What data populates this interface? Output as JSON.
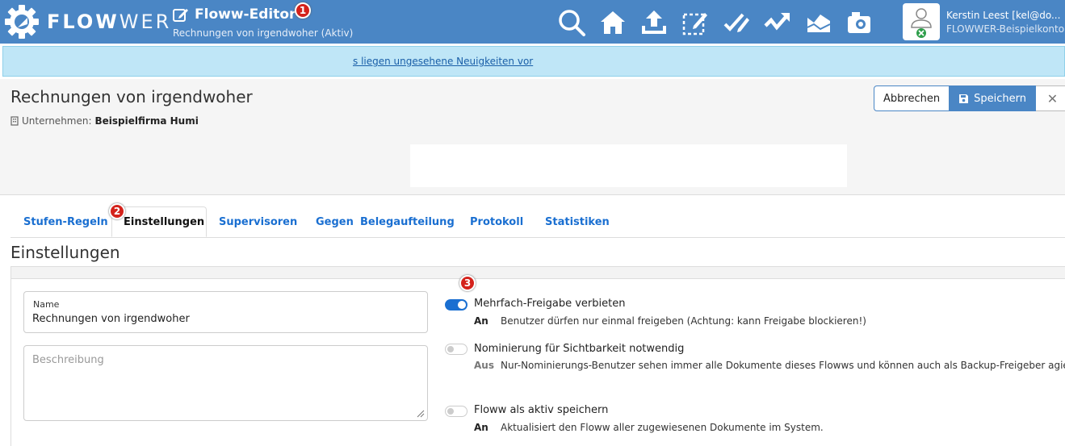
{
  "brand": {
    "logo_bold": "FLOW",
    "logo_thin": "WER",
    "accent": "#4a86c5",
    "danger": "#d4221b"
  },
  "editor": {
    "title": "Floww-Editor",
    "subtitle": "Rechnungen von irgendwoher (Aktiv)",
    "icon": "edit-icon"
  },
  "nav_icons": [
    "search-icon",
    "home-icon",
    "upload-icon",
    "selection-edit-icon",
    "sign-icon",
    "trend-icon",
    "chart-icon",
    "camera-icon"
  ],
  "user": {
    "name": "Kerstin Leest [kel@do...",
    "account": "FLOWWER-Beispielkonto"
  },
  "news": {
    "link": "s liegen ungesehene Neuigkeiten vor"
  },
  "header": {
    "title": "Rechnungen von irgendwoher",
    "company_label": "Unternehmen:",
    "company_value": "Beispielfirma Humi",
    "cancel": "Abbrechen",
    "save": "Speichern",
    "close": "✕"
  },
  "badges": [
    "1",
    "2",
    "3"
  ],
  "tabs": [
    {
      "label": "Stufen-Regeln"
    },
    {
      "label": "Einstellungen"
    },
    {
      "label": "Supervisoren"
    },
    {
      "label": "Gegen:"
    },
    {
      "label": "Belegaufteilung"
    },
    {
      "label": "Protokoll"
    },
    {
      "label": "Statistiken"
    }
  ],
  "section_title": "Einstellungen",
  "form": {
    "name_label": "Name",
    "name_value": "Rechnungen von irgendwoher",
    "description_placeholder": "Beschreibung"
  },
  "options": [
    {
      "label": "Mehrfach-Freigabe verbieten",
      "state": "An",
      "description": "Benutzer dürfen nur einmal freigeben (Achtung: kann Freigabe blockieren!)"
    },
    {
      "label": "Nominierung für Sichtbarkeit notwendig",
      "state": "Aus",
      "description": "Nur-Nominierungs-Benutzer sehen immer alle Dokumente dieses Flowws und können auch als Backup-Freigeber agieren"
    },
    {
      "label": "Floww als aktiv speichern",
      "state": "An",
      "description": "Aktualisiert den Floww aller zugewiesenen Dokumente im System."
    }
  ]
}
